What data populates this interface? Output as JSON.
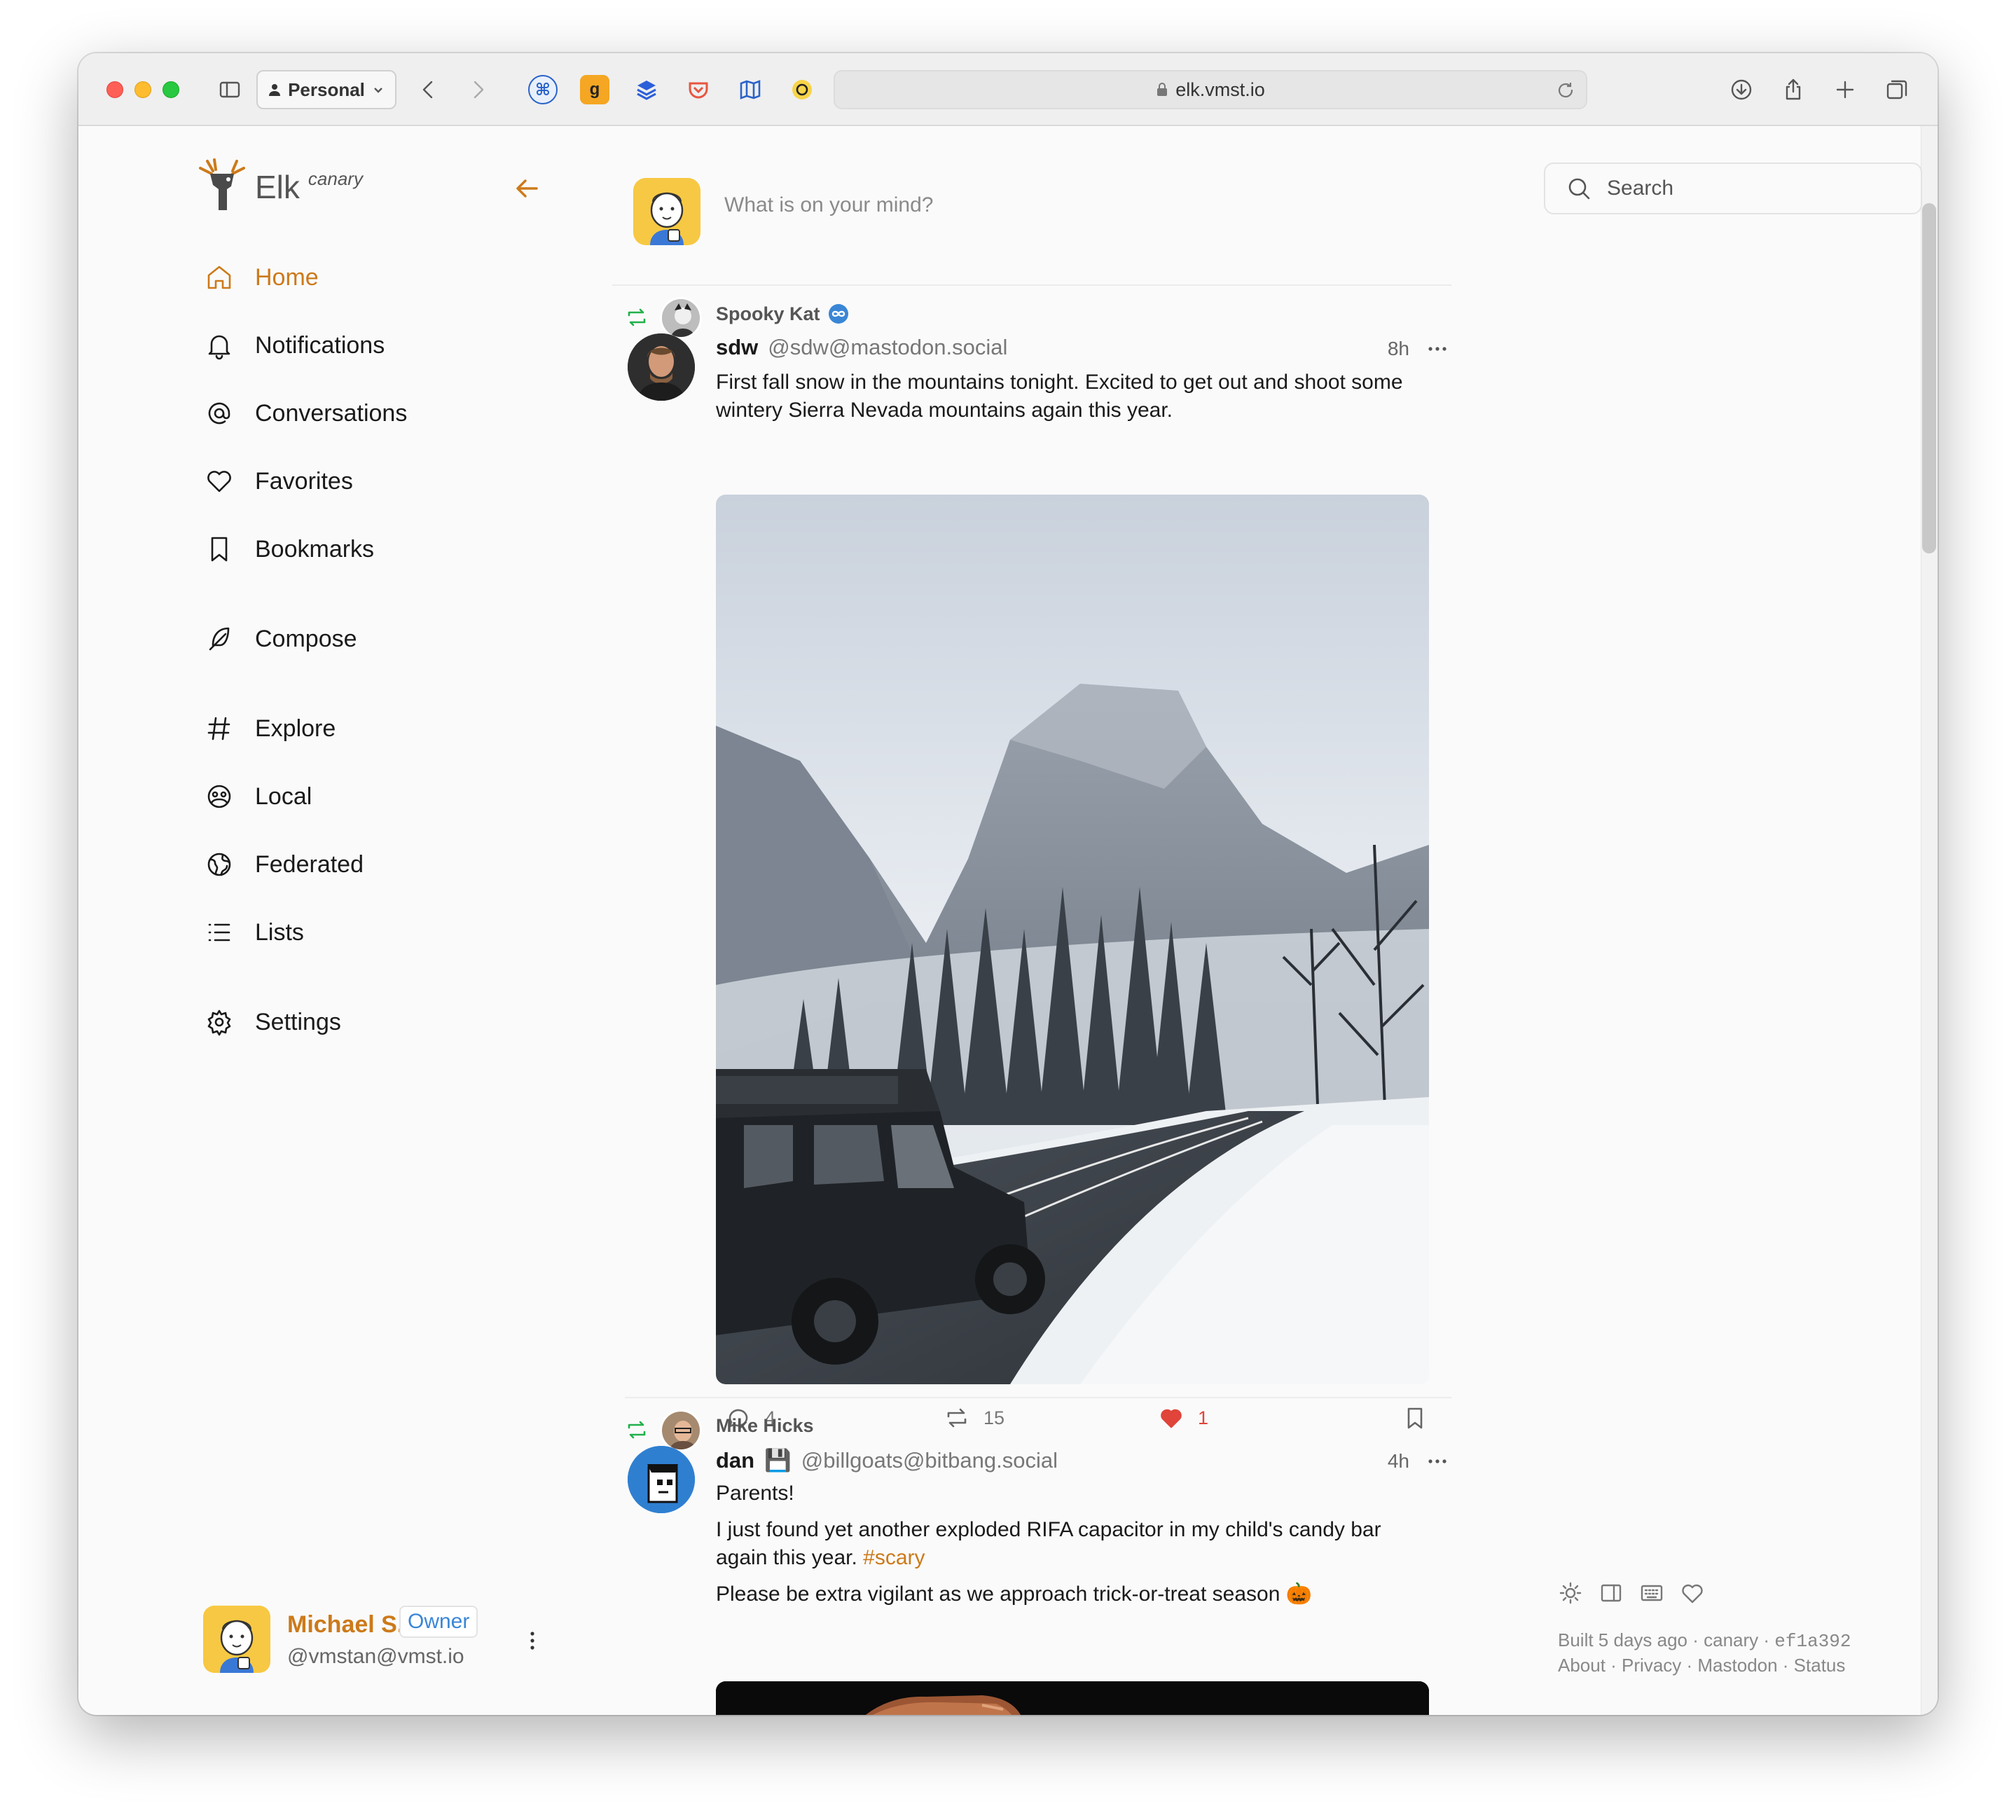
{
  "browser": {
    "profile": "Personal",
    "url": "elk.vmst.io"
  },
  "app": {
    "name": "Elk",
    "channel": "canary"
  },
  "nav": {
    "items": [
      {
        "label": "Home",
        "icon": "home-icon",
        "active": true
      },
      {
        "label": "Notifications",
        "icon": "bell-icon"
      },
      {
        "label": "Conversations",
        "icon": "at-icon"
      },
      {
        "label": "Favorites",
        "icon": "heart-icon"
      },
      {
        "label": "Bookmarks",
        "icon": "bookmark-icon"
      },
      {
        "label": "Compose",
        "icon": "feather-icon"
      },
      {
        "label": "Explore",
        "icon": "hash-icon"
      },
      {
        "label": "Local",
        "icon": "group-icon"
      },
      {
        "label": "Federated",
        "icon": "globe-icon"
      },
      {
        "label": "Lists",
        "icon": "list-icon"
      },
      {
        "label": "Settings",
        "icon": "gear-icon"
      }
    ]
  },
  "current_user": {
    "name": "Michael S...",
    "role": "Owner",
    "handle": "@vmstan@vmst.io"
  },
  "composer": {
    "placeholder": "What is on your mind?"
  },
  "posts": [
    {
      "boosted_by": "Spooky Kat",
      "author": "sdw",
      "handle": "@sdw@mastodon.social",
      "time": "8h",
      "text": "First fall snow in the mountains tonight. Excited to get out and shoot some wintery Sierra Nevada mountains again this year.",
      "replies": "4",
      "boosts": "15",
      "favorites": "1"
    },
    {
      "boosted_by": "Mike Hicks",
      "author": "dan",
      "author_emoji": "💾",
      "handle": "@billgoats@bitbang.social",
      "time": "4h",
      "paragraph1": "Parents!",
      "paragraph2": "I just found yet another exploded RIFA capacitor in my child's candy bar again this year.",
      "hashtag": "#scary",
      "paragraph3": "Please be extra vigilant as we approach trick-or-treat season 🎃"
    }
  ],
  "search": {
    "placeholder": "Search"
  },
  "footer": {
    "built": "Built 5 days ago · canary · ",
    "commit": "ef1a392",
    "links": "About · Privacy · Mastodon · Status"
  },
  "colors": {
    "accent": "#cc7a1a",
    "boost": "#22b04b",
    "favorite": "#e0443a",
    "role": "#3a86d6"
  }
}
